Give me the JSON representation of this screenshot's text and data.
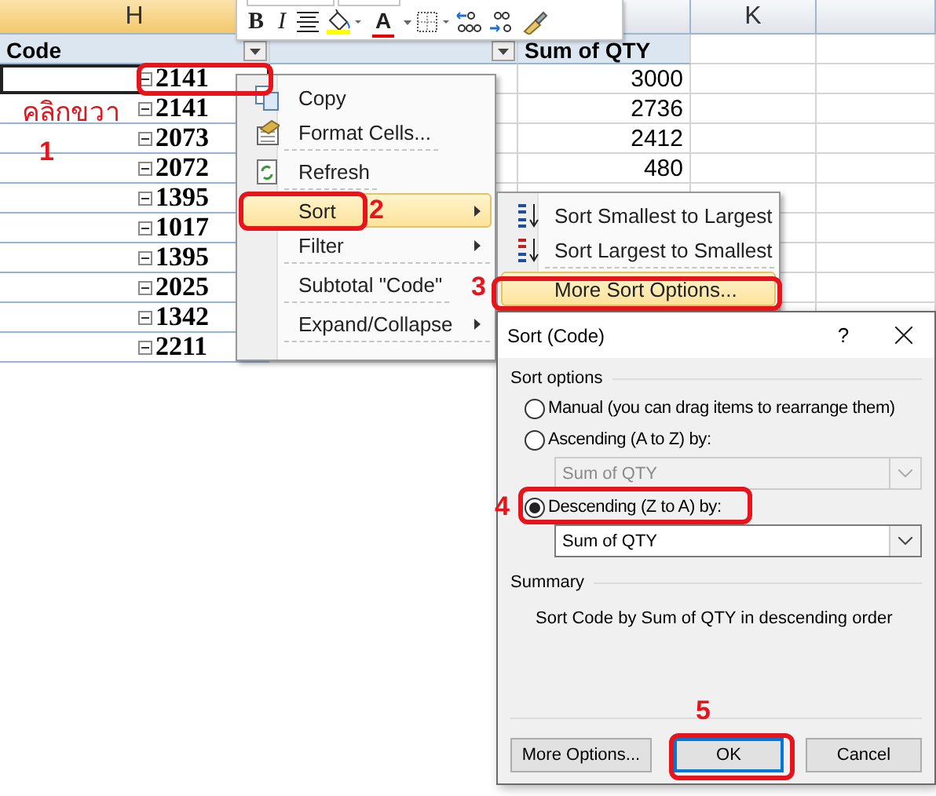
{
  "sheet": {
    "column_headers": [
      {
        "label": "H",
        "selected": true
      },
      {
        "label": "K",
        "selected": false
      }
    ],
    "pivot_headers": [
      {
        "label": "Code",
        "filter_button": true
      },
      {
        "filter_button": true
      },
      {
        "label": "Sum of QTY"
      }
    ],
    "rows": [
      {
        "code": "2141",
        "qty": "3000",
        "selected": true
      },
      {
        "code": "2141",
        "qty": "2736",
        "selected": false
      },
      {
        "code": "2073",
        "qty": "2412",
        "selected": false
      },
      {
        "code": "2072",
        "qty": "480",
        "selected": false
      },
      {
        "code": "1395",
        "selected": false
      },
      {
        "code": "1017",
        "selected": false
      },
      {
        "code": "1395",
        "selected": false
      },
      {
        "code": "2025",
        "selected": false
      },
      {
        "code": "1342",
        "selected": false
      },
      {
        "code": "2211",
        "selected": false
      }
    ]
  },
  "mini_toolbar": {
    "bold": "B",
    "italic": "I",
    "font_color": "A"
  },
  "context_menu": {
    "items": [
      {
        "label": "Copy",
        "submenu": false,
        "selected": false,
        "separator_after": false
      },
      {
        "label": "Format Cells...",
        "submenu": false,
        "selected": false,
        "separator_after": true
      },
      {
        "label": "Refresh",
        "submenu": false,
        "selected": false,
        "separator_after": true
      },
      {
        "label": "Sort",
        "submenu": true,
        "selected": true,
        "separator_after": false
      },
      {
        "label": "Filter",
        "submenu": true,
        "selected": false,
        "separator_after": true
      },
      {
        "label": "Subtotal \"Code\"",
        "submenu": false,
        "selected": false,
        "separator_after": true
      },
      {
        "label": "Expand/Collapse",
        "submenu": true,
        "selected": false,
        "separator_after": true
      }
    ]
  },
  "sort_submenu": {
    "items": [
      {
        "label": "Sort Smallest to Largest",
        "selected": false,
        "separator_after": false
      },
      {
        "label": "Sort Largest to Smallest",
        "selected": false,
        "separator_after": true
      },
      {
        "label": "More Sort Options...",
        "selected": true,
        "separator_after": false
      }
    ]
  },
  "dialog": {
    "title": "Sort (Code)",
    "help": "?",
    "sort_options": {
      "label": "Sort options",
      "choices": [
        {
          "label": "Manual (you can drag items to rearrange them)",
          "selected": false
        },
        {
          "label": "Ascending (A to Z) by:",
          "selected": false,
          "field": {
            "value": "Sum of QTY",
            "disabled": true
          }
        },
        {
          "label": "Descending (Z to A) by:",
          "selected": true,
          "field": {
            "value": "Sum of QTY",
            "disabled": false
          }
        }
      ]
    },
    "summary": {
      "label": "Summary",
      "text": "Sort Code by Sum of QTY in descending order"
    },
    "buttons": [
      {
        "label": "More Options...",
        "default": false
      },
      {
        "label": "OK",
        "default": true
      },
      {
        "label": "Cancel",
        "default": false
      }
    ]
  },
  "annotations": {
    "note": "คลิกขวา",
    "steps": [
      "1",
      "2",
      "3",
      "4",
      "5"
    ]
  }
}
